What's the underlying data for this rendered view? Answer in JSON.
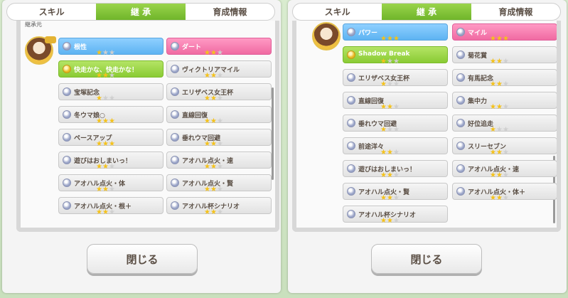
{
  "tabs": [
    "スキル",
    "継 承",
    "育成情報"
  ],
  "active_tab": "継 承",
  "left": {
    "section_label": "継承元",
    "skills": [
      {
        "name": "根性",
        "stars": 1,
        "max": 3,
        "color": "blue",
        "gold": false
      },
      {
        "name": "ダート",
        "stars": 2,
        "max": 3,
        "color": "pink",
        "gold": false
      },
      {
        "name": "快走かな、快走かな！",
        "stars": 2,
        "max": 3,
        "color": "green",
        "gold": true
      },
      {
        "name": "ヴィクトリアマイル",
        "stars": 2,
        "max": 3,
        "color": "white",
        "gold": false
      },
      {
        "name": "宝塚記念",
        "stars": 1,
        "max": 3,
        "color": "white",
        "gold": false
      },
      {
        "name": "エリザベス女王杯",
        "stars": 2,
        "max": 3,
        "color": "white",
        "gold": false
      },
      {
        "name": "冬ウマ娘○",
        "stars": 3,
        "max": 3,
        "color": "white",
        "gold": false
      },
      {
        "name": "直線回復",
        "stars": 2,
        "max": 3,
        "color": "white",
        "gold": false
      },
      {
        "name": "ペースアップ",
        "stars": 3,
        "max": 3,
        "color": "white",
        "gold": false
      },
      {
        "name": "垂れウマ回避",
        "stars": 2,
        "max": 3,
        "color": "white",
        "gold": false
      },
      {
        "name": "遊びはおしまいっ！",
        "stars": 2,
        "max": 3,
        "color": "white",
        "gold": false
      },
      {
        "name": "アオハル点火・速",
        "stars": 2,
        "max": 3,
        "color": "white",
        "gold": false
      },
      {
        "name": "アオハル点火・体",
        "stars": 2,
        "max": 3,
        "color": "white",
        "gold": false
      },
      {
        "name": "アオハル点火・賢",
        "stars": 2,
        "max": 3,
        "color": "white",
        "gold": false
      },
      {
        "name": "アオハル点火・根＋",
        "stars": 2,
        "max": 3,
        "color": "white",
        "gold": false
      },
      {
        "name": "アオハル杯シナリオ",
        "stars": 2,
        "max": 3,
        "color": "white",
        "gold": false
      }
    ],
    "close_label": "閉じる"
  },
  "right": {
    "skills": [
      {
        "name": "パワー",
        "stars": 3,
        "max": 3,
        "color": "blue",
        "gold": false
      },
      {
        "name": "マイル",
        "stars": 3,
        "max": 3,
        "color": "pink",
        "gold": false
      },
      {
        "name": "Shadow Break",
        "stars": 1,
        "max": 3,
        "color": "green",
        "gold": true
      },
      {
        "name": "菊花賞",
        "stars": 2,
        "max": 3,
        "color": "white",
        "gold": false
      },
      {
        "name": "エリザベス女王杯",
        "stars": 1,
        "max": 3,
        "color": "white",
        "gold": false
      },
      {
        "name": "有馬記念",
        "stars": 2,
        "max": 3,
        "color": "white",
        "gold": false
      },
      {
        "name": "直線回復",
        "stars": 2,
        "max": 3,
        "color": "white",
        "gold": false
      },
      {
        "name": "集中力",
        "stars": 2,
        "max": 3,
        "color": "white",
        "gold": false
      },
      {
        "name": "垂れウマ回避",
        "stars": 1,
        "max": 3,
        "color": "white",
        "gold": false
      },
      {
        "name": "好位追走",
        "stars": 1,
        "max": 3,
        "color": "white",
        "gold": false
      },
      {
        "name": "前途洋々",
        "stars": 2,
        "max": 3,
        "color": "white",
        "gold": false
      },
      {
        "name": "スリーセブン",
        "stars": 2,
        "max": 3,
        "color": "white",
        "gold": false
      },
      {
        "name": "遊びはおしまいっ！",
        "stars": 2,
        "max": 3,
        "color": "white",
        "gold": false
      },
      {
        "name": "アオハル点火・速",
        "stars": 2,
        "max": 3,
        "color": "white",
        "gold": false
      },
      {
        "name": "アオハル点火・賢",
        "stars": 2,
        "max": 3,
        "color": "white",
        "gold": false
      },
      {
        "name": "アオハル点火・体＋",
        "stars": 2,
        "max": 3,
        "color": "white",
        "gold": false
      },
      {
        "name": "アオハル杯シナリオ",
        "stars": 2,
        "max": 3,
        "color": "white",
        "gold": false
      }
    ],
    "close_label": "閉じる"
  },
  "colors": {
    "active_tab": "#7cc232",
    "blue_skill": "#5db3f2",
    "pink_skill": "#f06aa2",
    "green_skill": "#8acb34",
    "star": "#f5c21a"
  }
}
